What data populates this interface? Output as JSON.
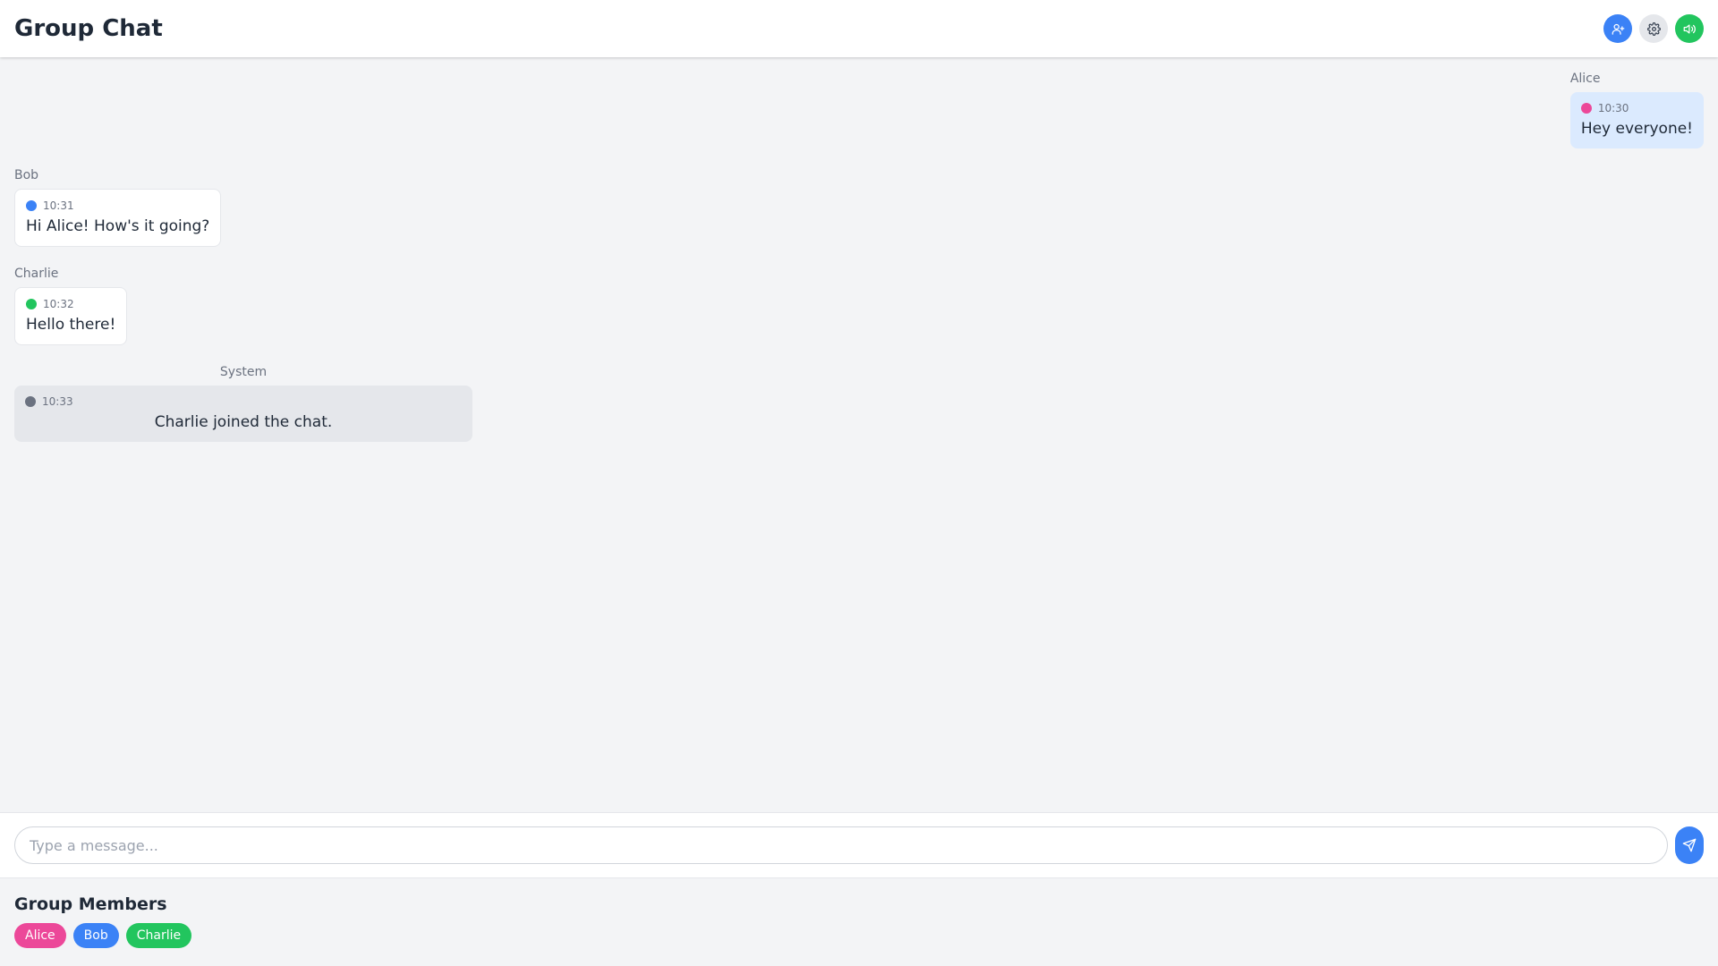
{
  "header": {
    "title": "Group Chat",
    "actions": [
      {
        "icon": "add-user-icon",
        "color": "#3b82f6"
      },
      {
        "icon": "gear-icon",
        "color": "#e5e7eb"
      },
      {
        "icon": "speaker-icon",
        "color": "#22c55e"
      }
    ]
  },
  "messages": [
    {
      "sender": "Alice",
      "time": "10:30",
      "text": "Hey everyone!",
      "dot_color": "#ec4899",
      "type": "self"
    },
    {
      "sender": "Bob",
      "time": "10:31",
      "text": "Hi Alice! How's it going?",
      "dot_color": "#3b82f6",
      "type": "other"
    },
    {
      "sender": "Charlie",
      "time": "10:32",
      "text": "Hello there!",
      "dot_color": "#22c55e",
      "type": "other"
    },
    {
      "sender": "System",
      "time": "10:33",
      "text": "Charlie joined the chat.",
      "dot_color": "#6b7280",
      "type": "system"
    }
  ],
  "input": {
    "placeholder": "Type a message...",
    "value": ""
  },
  "send": {
    "icon": "send-icon"
  },
  "members": {
    "title": "Group Members",
    "list": [
      {
        "name": "Alice",
        "color": "#ec4899"
      },
      {
        "name": "Bob",
        "color": "#3b82f6"
      },
      {
        "name": "Charlie",
        "color": "#22c55e"
      }
    ]
  }
}
